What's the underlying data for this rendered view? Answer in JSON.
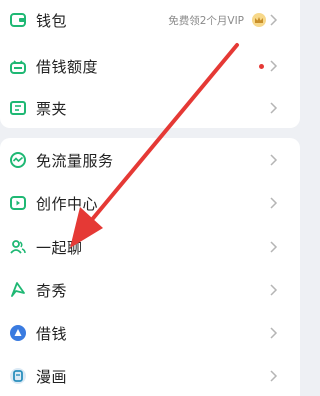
{
  "section1": {
    "items": [
      {
        "label": "钱包",
        "icon": "wallet-icon",
        "extra": "免费领2个月VIP"
      },
      {
        "label": "借钱额度",
        "icon": "robot-icon"
      },
      {
        "label": "票夹",
        "icon": "ticket-icon"
      }
    ]
  },
  "section2": {
    "items": [
      {
        "label": "免流量服务",
        "icon": "data-wave-icon"
      },
      {
        "label": "创作中心",
        "icon": "creator-icon"
      },
      {
        "label": "一起聊",
        "icon": "chat-people-icon"
      },
      {
        "label": "奇秀",
        "icon": "qixiu-icon"
      },
      {
        "label": "借钱",
        "icon": "loan-icon"
      },
      {
        "label": "漫画",
        "icon": "comic-icon"
      }
    ]
  },
  "colors": {
    "accent": "#1fb874",
    "blue": "#3a7be0",
    "annotation_arrow": "#e53935"
  }
}
